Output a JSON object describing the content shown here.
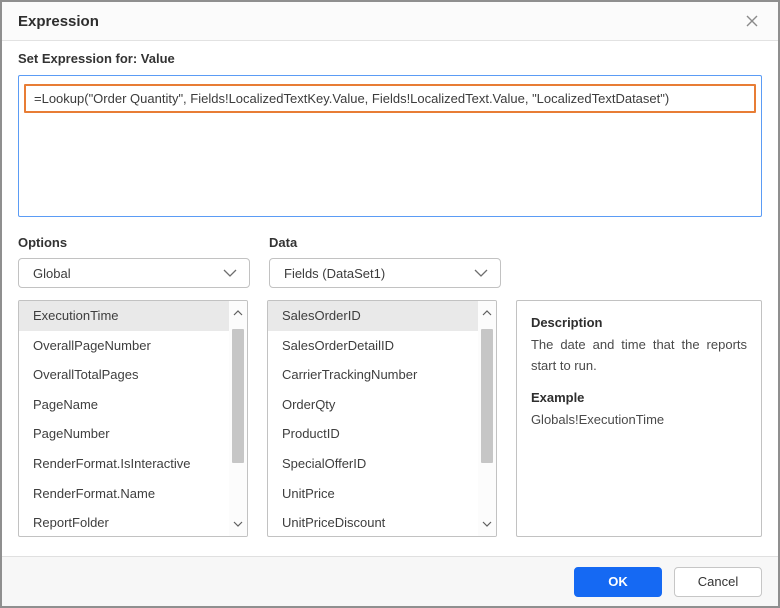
{
  "dialog": {
    "title": "Expression",
    "set_expression_label": "Set Expression for: Value",
    "expression": "=Lookup(\"Order Quantity\", Fields!LocalizedTextKey.Value, Fields!LocalizedText.Value, \"LocalizedTextDataset\")",
    "options_dropdown": {
      "label": "Options",
      "selected_value": "Global"
    },
    "data_dropdown": {
      "label": "Data",
      "selected_value": "Fields (DataSet1)"
    },
    "lists": {
      "globals": {
        "selected_index": 0,
        "items": [
          "ExecutionTime",
          "OverallPageNumber",
          "OverallTotalPages",
          "PageName",
          "PageNumber",
          "RenderFormat.IsInteractive",
          "RenderFormat.Name",
          "ReportFolder"
        ]
      },
      "fields": {
        "selected_index": 0,
        "items": [
          "SalesOrderID",
          "SalesOrderDetailID",
          "CarrierTrackingNumber",
          "OrderQty",
          "ProductID",
          "SpecialOfferID",
          "UnitPrice",
          "UnitPriceDiscount"
        ]
      }
    },
    "description_panel": {
      "description_heading": "Description",
      "description_text": "The date and time that the reports start to run.",
      "example_heading": "Example",
      "example_text": "Globals!ExecutionTime"
    },
    "buttons": {
      "ok": "OK",
      "cancel": "Cancel"
    },
    "colors": {
      "ok_button_blue": "#1569f3",
      "expression_border_blue": "#5b9cf5",
      "expression_highlight_orange": "#e87d35",
      "selected_row_gray": "#e9e9e9"
    }
  }
}
